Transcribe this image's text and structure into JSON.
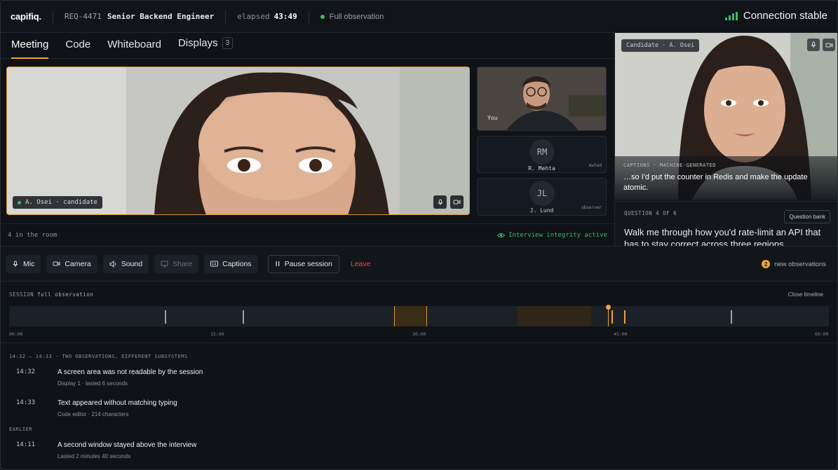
{
  "header": {
    "logo": "capifiq.",
    "req_id": "REQ-4471",
    "req_title": "Senior Backend Engineer",
    "elapsed_label": "elapsed",
    "elapsed_value": "43:49",
    "observation_mode": "Full observation",
    "connection_status": "Connection stable"
  },
  "tabs": [
    {
      "label": "Meeting",
      "active": true
    },
    {
      "label": "Code"
    },
    {
      "label": "Whiteboard"
    },
    {
      "label": "Displays",
      "count": "3"
    }
  ],
  "main_video": {
    "name_tag": "A. Osei · candidate"
  },
  "side_tiles": {
    "you": {
      "label": "You"
    },
    "p1": {
      "initials": "RM",
      "name": "R. Mehta",
      "tag": "muted"
    },
    "p2": {
      "initials": "JL",
      "name": "J. Lund",
      "tag": "observer"
    }
  },
  "room": {
    "count": "4 in the room",
    "integrity": "Interview integrity active"
  },
  "right_panel": {
    "video_tag": "Candidate · A. Osei",
    "captions_label": "CAPTIONS · MACHINE-GENERATED",
    "captions_text": "…so I'd put the counter in Redis and make the update atomic.",
    "question_label": "QUESTION 4 OF 6",
    "question_bank": "Question bank",
    "question_text": "Walk me through how you'd rate-limit an API that has to stay correct across three regions."
  },
  "controls": {
    "mic": "Mic",
    "camera": "Camera",
    "sound": "Sound",
    "share": "Share",
    "captions": "Captions",
    "pause": "Pause session",
    "leave": "Leave",
    "new_obs_count": "2",
    "new_obs_label": "new observations"
  },
  "timeline": {
    "session_label": "SESSION",
    "mode": "full observation",
    "close": "Close timeline",
    "ticks": [
      "00:00",
      "15:00",
      "30:00",
      "45:00",
      "60:00"
    ]
  },
  "observations": {
    "group1": "14:32 – 14:33 · TWO OBSERVATIONS, DIFFERENT SUBSYSTEMS",
    "items1": [
      {
        "time": "14:32",
        "title": "A screen area was not readable by the session",
        "sub": "Display 1 · lasted 6 seconds"
      },
      {
        "time": "14:33",
        "title": "Text appeared without matching typing",
        "sub": "Code editor · 214 characters"
      }
    ],
    "group2": "EARLIER",
    "items2": [
      {
        "time": "14:11",
        "title": "A second window stayed above the interview",
        "sub": "Lasted 2 minutes 40 seconds"
      }
    ]
  },
  "colors": {
    "accent": "#f0a43a",
    "ok": "#3fb96b",
    "danger": "#ef4d3f"
  }
}
